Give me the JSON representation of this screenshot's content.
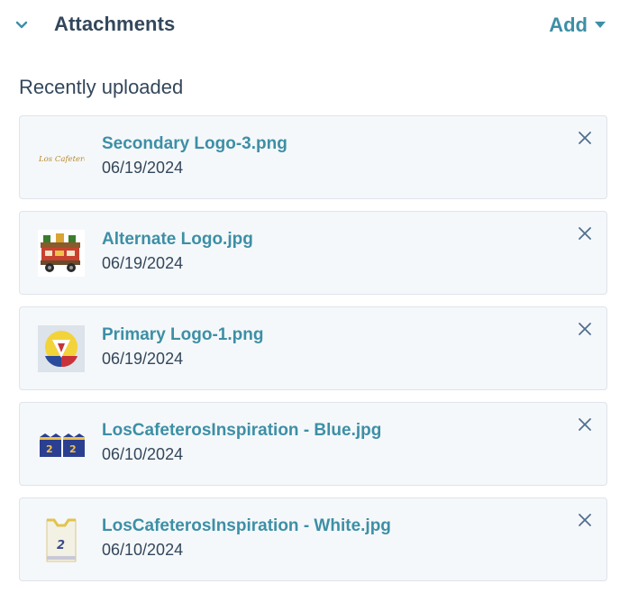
{
  "header": {
    "title": "Attachments",
    "add_label": "Add"
  },
  "section": {
    "label": "Recently uploaded"
  },
  "attachments": [
    {
      "name": "Secondary Logo-3.png",
      "date": "06/19/2024",
      "thumb_text": "Los Cafeteros"
    },
    {
      "name": "Alternate Logo.jpg",
      "date": "06/19/2024"
    },
    {
      "name": "Primary Logo-1.png",
      "date": "06/19/2024"
    },
    {
      "name": "LosCafeterosInspiration - Blue.jpg",
      "date": "06/10/2024",
      "thumb_text": "2"
    },
    {
      "name": "LosCafeterosInspiration - White.jpg",
      "date": "06/10/2024",
      "thumb_text": "2"
    }
  ],
  "colors": {
    "accent": "#3d8fa6",
    "text": "#33475b",
    "card_bg": "#f5f8fa",
    "card_border": "#dfe3eb"
  }
}
